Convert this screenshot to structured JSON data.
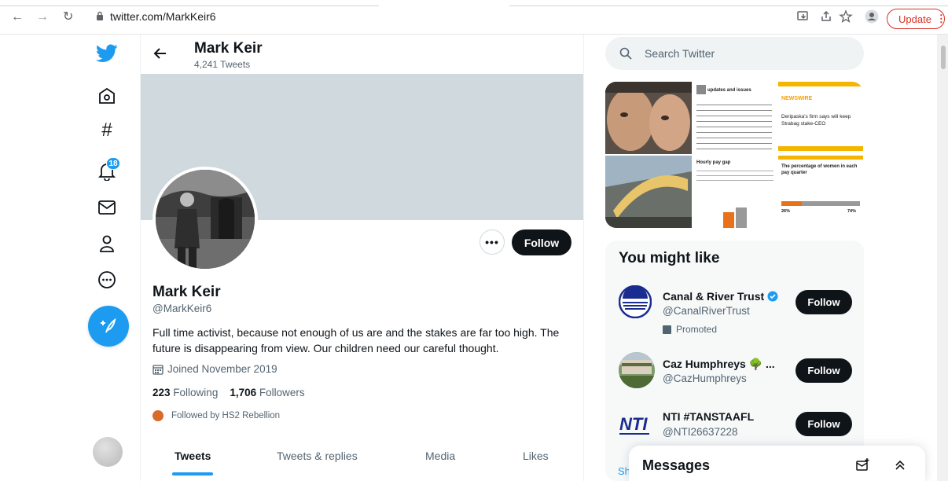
{
  "browser": {
    "url": "twitter.com/MarkKeir6",
    "update_label": "Update"
  },
  "nav": {
    "notifications_count": "18"
  },
  "header": {
    "name": "Mark Keir",
    "tweet_count": "4,241 Tweets"
  },
  "profile": {
    "name": "Mark Keir",
    "handle": "@MarkKeir6",
    "bio": "Full time activist, because not enough of us are and the stakes are far too high. The future is disappearing from view. Our children need our careful thought.",
    "joined": "Joined November 2019",
    "following_count": "223",
    "following_label": "Following",
    "followers_count": "1,706",
    "followers_label": "Followers",
    "followed_by": "Followed by HS2 Rebellion",
    "follow_label": "Follow",
    "more_label": "•••"
  },
  "tabs": [
    "Tweets",
    "Tweets & replies",
    "Media",
    "Likes"
  ],
  "search": {
    "placeholder": "Search Twitter"
  },
  "media": {
    "tweet_title": "updates and issues",
    "newswire": "NEWSWIRE",
    "newswire_headline": "Deripaska's firm says will keep Strabag stake-CEO",
    "chart_title": "The percentage of women in each pay quarter",
    "hourly_pay": "Hourly pay gap",
    "pct_a": "26%",
    "pct_b": "74%"
  },
  "who_to_follow": {
    "title": "You might like",
    "accounts": [
      {
        "name": "Canal & River Trust",
        "handle": "@CanalRiverTrust",
        "promoted": "Promoted",
        "follow": "Follow"
      },
      {
        "name": "Caz Humphreys 🌳 ...",
        "handle": "@CazHumphreys",
        "follow": "Follow"
      },
      {
        "name": "NTI #TANSTAAFL",
        "handle": "@NTI26637228",
        "follow": "Follow"
      }
    ],
    "show_more": "Sh"
  },
  "messages": {
    "title": "Messages"
  },
  "colors": {
    "accent": "#1d9bf0",
    "dark": "#0f1419",
    "update_red": "#d93025"
  }
}
